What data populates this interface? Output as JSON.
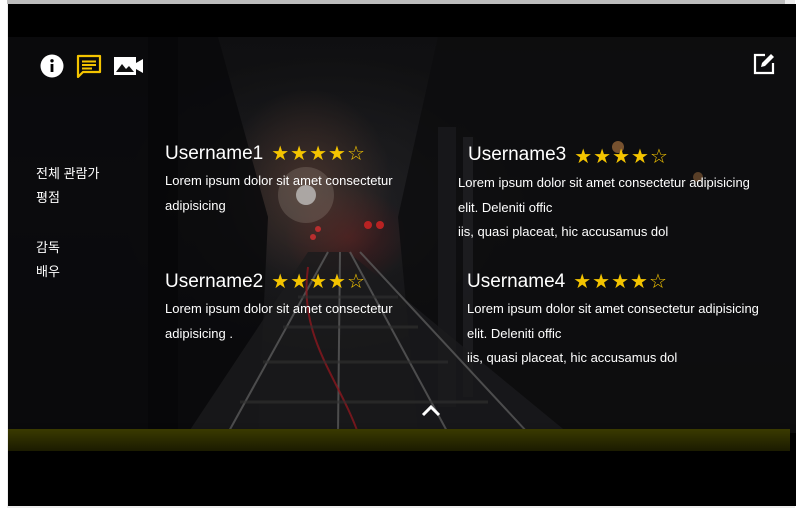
{
  "toolbar": {
    "icons": [
      "info-icon",
      "comment-icon",
      "video-gallery-icon"
    ],
    "edit_icon": "edit-icon",
    "accent": "#f4c400"
  },
  "sidebar": {
    "items": [
      "전체 관람가",
      "평점",
      "감독",
      "배우"
    ]
  },
  "reviews": [
    {
      "username": "Username1",
      "rating": 4,
      "max_rating": 5,
      "lines": [
        "Lorem ipsum dolor sit amet consectetur",
        "adipisicing"
      ]
    },
    {
      "username": "Username3",
      "rating": 4,
      "max_rating": 5,
      "lines": [
        "Lorem ipsum dolor sit amet consectetur adipisicing",
        "elit. Deleniti offic",
        "iis, quasi placeat, hic accusamus dol"
      ]
    },
    {
      "username": "Username2",
      "rating": 4,
      "max_rating": 5,
      "lines": [
        "Lorem ipsum dolor sit amet consectetur",
        "adipisicing ."
      ]
    },
    {
      "username": "Username4",
      "rating": 4,
      "max_rating": 5,
      "lines": [
        "Lorem ipsum dolor sit amet consectetur adipisicing",
        "elit. Deleniti offic",
        "iis, quasi placeat, hic accusamus dol"
      ]
    }
  ],
  "collapse_icon": "chevron-up-icon",
  "colors": {
    "star": "#f4c400",
    "highlight_bar": "#3a3a00"
  }
}
